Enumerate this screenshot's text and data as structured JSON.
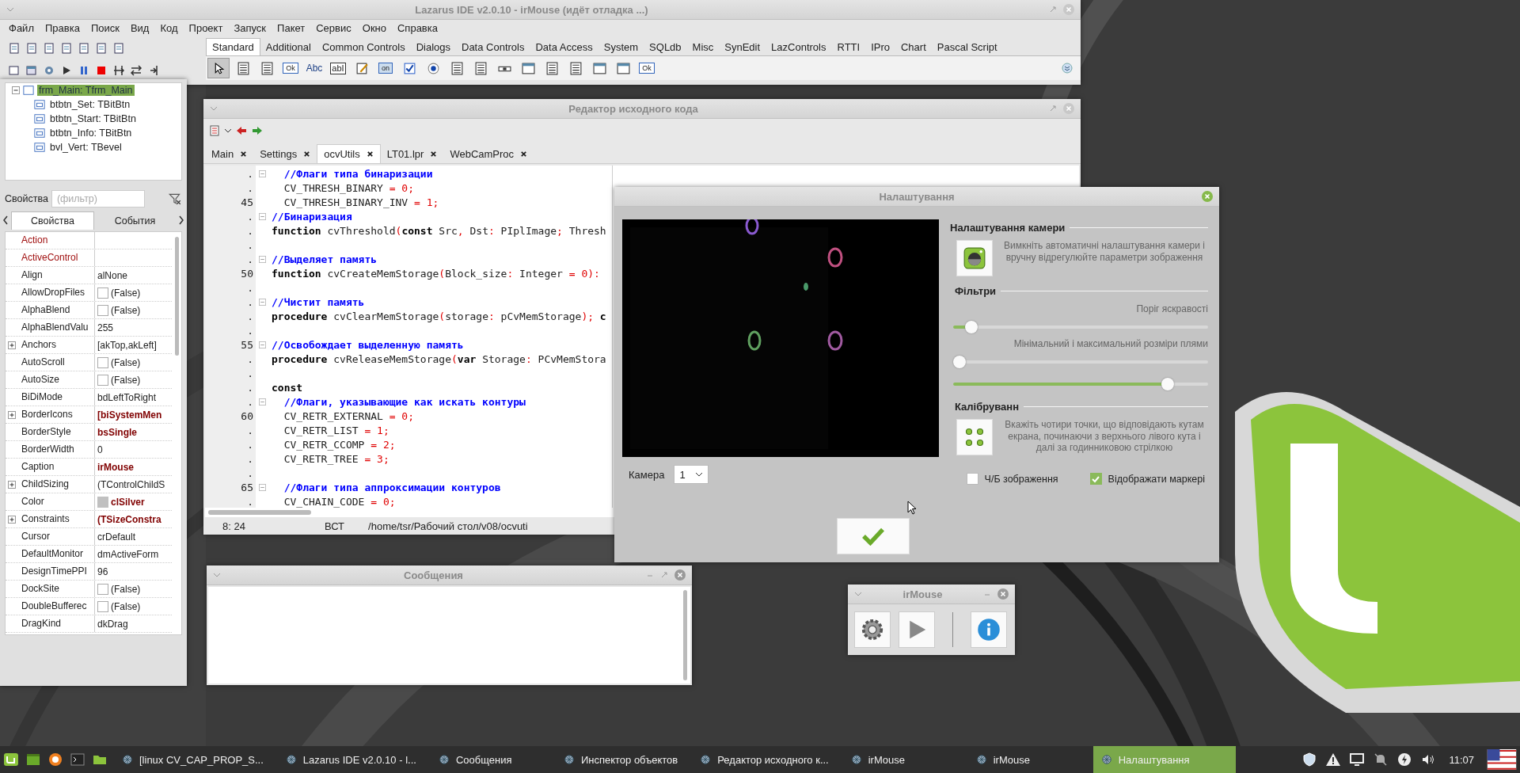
{
  "ide": {
    "title": "Lazarus IDE v2.0.10 - irMouse (идёт отладка ...)",
    "menu": [
      "Файл",
      "Правка",
      "Поиск",
      "Вид",
      "Код",
      "Проект",
      "Запуск",
      "Пакет",
      "Сервис",
      "Окно",
      "Справка"
    ],
    "palette_tabs": [
      {
        "label": "Standard",
        "selected": true
      },
      {
        "label": "Additional",
        "selected": false
      },
      {
        "label": "Common Controls",
        "selected": false
      },
      {
        "label": "Dialogs",
        "selected": false
      },
      {
        "label": "Data Controls",
        "selected": false
      },
      {
        "label": "Data Access",
        "selected": false
      },
      {
        "label": "System",
        "selected": false
      },
      {
        "label": "SQLdb",
        "selected": false
      },
      {
        "label": "Misc",
        "selected": false
      },
      {
        "label": "SynEdit",
        "selected": false
      },
      {
        "label": "LazControls",
        "selected": false
      },
      {
        "label": "RTTI",
        "selected": false
      },
      {
        "label": "IPro",
        "selected": false
      },
      {
        "label": "Chart",
        "selected": false
      },
      {
        "label": "Pascal Script",
        "selected": false
      }
    ],
    "palette_items": [
      {
        "kind": "pointer",
        "selected": true
      },
      {
        "kind": "list",
        "selected": false
      },
      {
        "kind": "list",
        "selected": false
      },
      {
        "kind": "button",
        "label": "Ok",
        "selected": false
      },
      {
        "kind": "label",
        "label": "Abc",
        "selected": false
      },
      {
        "kind": "edit",
        "label": "abI",
        "selected": false
      },
      {
        "kind": "memo",
        "selected": false
      },
      {
        "kind": "toggle",
        "label": "on",
        "selected": false
      },
      {
        "kind": "check",
        "selected": false
      },
      {
        "kind": "radio",
        "selected": false
      },
      {
        "kind": "list",
        "selected": false
      },
      {
        "kind": "list",
        "selected": false
      },
      {
        "kind": "scroll",
        "selected": false
      },
      {
        "kind": "panel",
        "selected": false
      },
      {
        "kind": "list",
        "selected": false
      },
      {
        "kind": "list",
        "selected": false
      },
      {
        "kind": "panel",
        "selected": false
      },
      {
        "kind": "panel",
        "selected": false
      },
      {
        "kind": "button",
        "label": "Ok",
        "selected": false
      }
    ]
  },
  "inspector": {
    "tree": [
      {
        "label": "frm_Main: Tfrm_Main",
        "selected": true,
        "children": [
          {
            "label": "btbtn_Set: TBitBtn",
            "selected": false
          },
          {
            "label": "btbtn_Start: TBitBtn",
            "selected": false
          },
          {
            "label": "btbtn_Info: TBitBtn",
            "selected": false
          },
          {
            "label": "bvl_Vert: TBevel",
            "selected": false
          }
        ]
      }
    ],
    "filter_label": "Свойства",
    "filter_placeholder": "(фильтр)",
    "tabs": [
      {
        "label": "Свойства",
        "selected": true
      },
      {
        "label": "События",
        "selected": false
      }
    ],
    "rows": [
      {
        "name": "Action",
        "kind": "text",
        "highlight": true,
        "expandable": false
      },
      {
        "name": "ActiveControl",
        "kind": "text",
        "highlight": true,
        "expandable": false
      },
      {
        "name": "Align",
        "value": "alNone",
        "kind": "text",
        "highlight": false,
        "expandable": false
      },
      {
        "name": "AllowDropFiles",
        "value": "(False)",
        "kind": "check",
        "checked": false,
        "highlight": false,
        "expandable": false
      },
      {
        "name": "AlphaBlend",
        "value": "(False)",
        "kind": "check",
        "checked": false,
        "highlight": false,
        "expandable": false
      },
      {
        "name": "AlphaBlendValu",
        "value": "255",
        "kind": "text",
        "highlight": false,
        "expandable": false
      },
      {
        "name": "Anchors",
        "value": "[akTop,akLeft]",
        "kind": "text",
        "highlight": false,
        "expandable": true
      },
      {
        "name": "AutoScroll",
        "value": "(False)",
        "kind": "check",
        "checked": false,
        "highlight": false,
        "expandable": false
      },
      {
        "name": "AutoSize",
        "value": "(False)",
        "kind": "check",
        "checked": false,
        "highlight": false,
        "expandable": false
      },
      {
        "name": "BiDiMode",
        "value": "bdLeftToRight",
        "kind": "text",
        "highlight": false,
        "expandable": false
      },
      {
        "name": "BorderIcons",
        "value": "[biSystemMen",
        "kind": "bold",
        "highlight": false,
        "expandable": true
      },
      {
        "name": "BorderStyle",
        "value": "bsSingle",
        "kind": "bold",
        "highlight": false,
        "expandable": false
      },
      {
        "name": "BorderWidth",
        "value": "0",
        "kind": "text",
        "highlight": false,
        "expandable": false
      },
      {
        "name": "Caption",
        "value": "irMouse",
        "kind": "bold",
        "highlight": false,
        "expandable": false
      },
      {
        "name": "ChildSizing",
        "value": "(TControlChildS",
        "kind": "text",
        "highlight": false,
        "expandable": true
      },
      {
        "name": "Color",
        "value": "clSilver",
        "kind": "color",
        "highlight": false,
        "expandable": false
      },
      {
        "name": "Constraints",
        "value": "(TSizeConstra",
        "kind": "bold",
        "highlight": false,
        "expandable": true
      },
      {
        "name": "Cursor",
        "value": "crDefault",
        "kind": "text",
        "highlight": false,
        "expandable": false
      },
      {
        "name": "DefaultMonitor",
        "value": "dmActiveForm",
        "kind": "text",
        "highlight": false,
        "expandable": false
      },
      {
        "name": "DesignTimePPI",
        "value": "96",
        "kind": "text",
        "highlight": false,
        "expandable": false
      },
      {
        "name": "DockSite",
        "value": "(False)",
        "kind": "check",
        "checked": false,
        "highlight": false,
        "expandable": false
      },
      {
        "name": "DoubleBufferec",
        "value": "(False)",
        "kind": "check",
        "checked": false,
        "highlight": false,
        "expandable": false
      },
      {
        "name": "DragKind",
        "value": "dkDrag",
        "kind": "text",
        "highlight": false,
        "expandable": false
      }
    ]
  },
  "editor": {
    "title": "Редактор исходного кода",
    "tabs": [
      {
        "label": "Main",
        "selected": false
      },
      {
        "label": "Settings",
        "selected": false
      },
      {
        "label": "ocvUtils",
        "selected": true
      },
      {
        "label": "LT01.lpr",
        "selected": false
      },
      {
        "label": "WebCamProc",
        "selected": false
      }
    ],
    "lines": [
      {
        "number": ".",
        "fold": true,
        "segments": [
          {
            "kind": "comment",
            "text": "  //Флаги типа бинаризации"
          }
        ]
      },
      {
        "number": ".",
        "fold": false,
        "segments": [
          {
            "kind": "text",
            "text": "  CV_THRESH_BINARY "
          },
          {
            "kind": "symbol",
            "text": "= 0;"
          }
        ]
      },
      {
        "number": "45",
        "fold": false,
        "segments": [
          {
            "kind": "text",
            "text": "  CV_THRESH_BINARY_INV "
          },
          {
            "kind": "symbol",
            "text": "= 1;"
          }
        ]
      },
      {
        "number": ".",
        "fold": true,
        "segments": [
          {
            "kind": "comment",
            "text": "//Бинаризация"
          }
        ]
      },
      {
        "number": ".",
        "fold": false,
        "segments": [
          {
            "kind": "keyword",
            "text": "function"
          },
          {
            "kind": "text",
            "text": " cvThreshold"
          },
          {
            "kind": "symbol",
            "text": "("
          },
          {
            "kind": "keyword",
            "text": "const"
          },
          {
            "kind": "text",
            "text": " Src"
          },
          {
            "kind": "symbol",
            "text": ","
          },
          {
            "kind": "text",
            "text": " Dst"
          },
          {
            "kind": "symbol",
            "text": ":"
          },
          {
            "kind": "text",
            "text": " PIplImage"
          },
          {
            "kind": "symbol",
            "text": ";"
          },
          {
            "kind": "text",
            "text": " Thresh"
          }
        ]
      },
      {
        "number": ".",
        "fold": false
      },
      {
        "number": ".",
        "fold": true,
        "segments": [
          {
            "kind": "comment",
            "text": "//Выделяет память"
          }
        ]
      },
      {
        "number": "50",
        "fold": false,
        "segments": [
          {
            "kind": "keyword",
            "text": "function"
          },
          {
            "kind": "text",
            "text": " cvCreateMemStorage"
          },
          {
            "kind": "symbol",
            "text": "("
          },
          {
            "kind": "text",
            "text": "Block_size"
          },
          {
            "kind": "symbol",
            "text": ":"
          },
          {
            "kind": "text",
            "text": " Integer "
          },
          {
            "kind": "symbol",
            "text": "= 0):"
          }
        ]
      },
      {
        "number": ".",
        "fold": false
      },
      {
        "number": ".",
        "fold": true,
        "segments": [
          {
            "kind": "comment",
            "text": "//Чистит память"
          }
        ]
      },
      {
        "number": ".",
        "fold": false,
        "segments": [
          {
            "kind": "keyword",
            "text": "procedure"
          },
          {
            "kind": "text",
            "text": " cvClearMemStorage"
          },
          {
            "kind": "symbol",
            "text": "("
          },
          {
            "kind": "text",
            "text": "storage"
          },
          {
            "kind": "symbol",
            "text": ":"
          },
          {
            "kind": "text",
            "text": " pCvMemStorage"
          },
          {
            "kind": "symbol",
            "text": ");"
          },
          {
            "kind": "keyword",
            "text": " c"
          }
        ]
      },
      {
        "number": ".",
        "fold": false
      },
      {
        "number": "55",
        "fold": true,
        "segments": [
          {
            "kind": "comment",
            "text": "//Освобождает выделенную память"
          }
        ]
      },
      {
        "number": ".",
        "fold": false,
        "segments": [
          {
            "kind": "keyword",
            "text": "procedure"
          },
          {
            "kind": "text",
            "text": " cvReleaseMemStorage"
          },
          {
            "kind": "symbol",
            "text": "("
          },
          {
            "kind": "keyword",
            "text": "var"
          },
          {
            "kind": "text",
            "text": " Storage"
          },
          {
            "kind": "symbol",
            "text": ":"
          },
          {
            "kind": "text",
            "text": " PCvMemStora"
          }
        ]
      },
      {
        "number": ".",
        "fold": false
      },
      {
        "number": ".",
        "fold": false,
        "segments": [
          {
            "kind": "keyword",
            "text": "const"
          }
        ]
      },
      {
        "number": ".",
        "fold": true,
        "segments": [
          {
            "kind": "comment",
            "text": "  //Флаги, указывающие как искать контуры"
          }
        ]
      },
      {
        "number": "60",
        "fold": false,
        "segments": [
          {
            "kind": "text",
            "text": "  CV_RETR_EXTERNAL "
          },
          {
            "kind": "symbol",
            "text": "= 0;"
          }
        ]
      },
      {
        "number": ".",
        "fold": false,
        "segments": [
          {
            "kind": "text",
            "text": "  CV_RETR_LIST "
          },
          {
            "kind": "symbol",
            "text": "= 1;"
          }
        ]
      },
      {
        "number": ".",
        "fold": false,
        "segments": [
          {
            "kind": "text",
            "text": "  CV_RETR_CCOMP "
          },
          {
            "kind": "symbol",
            "text": "= 2;"
          }
        ]
      },
      {
        "number": ".",
        "fold": false,
        "segments": [
          {
            "kind": "text",
            "text": "  CV_RETR_TREE "
          },
          {
            "kind": "symbol",
            "text": "= 3;"
          }
        ]
      },
      {
        "number": ".",
        "fold": false
      },
      {
        "number": "65",
        "fold": true,
        "segments": [
          {
            "kind": "comment",
            "text": "  //Флаги типа аппроксимации контуров"
          }
        ]
      },
      {
        "number": ".",
        "fold": false,
        "segments": [
          {
            "kind": "text",
            "text": "  CV_CHAIN_CODE "
          },
          {
            "kind": "symbol",
            "text": "= 0;"
          }
        ]
      }
    ],
    "status": {
      "position": "8: 24",
      "mode": "ВСТ",
      "path": "/home/tsr/Рабочий стол/v08/ocvuti"
    }
  },
  "settings": {
    "title": "Налаштування",
    "camera_section": {
      "title": "Налаштування камери",
      "description": "Вимкніть автоматичні налаштування камери і вручну відрегулюйте параметри зображення"
    },
    "filters": {
      "title": "Фільтри",
      "brightness_label": "Поріг яскравості",
      "brightness": {
        "level": 0.05
      },
      "size_label": "Мінімальний і максимальний розміри плями",
      "size_min": {
        "level": 0
      },
      "size_max": {
        "level": 0.86
      }
    },
    "calibration": {
      "title": "Калібруванн",
      "description": "Вкажіть чотири точки, що відповідають кутам екрана, починаючи з верхнього лівого кута і далі за годинниковою стрілкою"
    },
    "camera_label": "Камера",
    "camera_value": "1",
    "checkboxes": [
      {
        "label": "Ч/Б зображення",
        "checked": false
      },
      {
        "label": "Відображати маркері",
        "checked": true
      }
    ]
  },
  "messages": {
    "title": "Сообщения"
  },
  "irmouse": {
    "title": "irMouse",
    "buttons": [
      {
        "kind": "settings"
      },
      {
        "kind": "play"
      },
      {
        "kind": "info"
      }
    ]
  },
  "taskbar": {
    "tasks": [
      {
        "label": "[linux CV_CAP_PROP_S...",
        "selected": false
      },
      {
        "label": "Lazarus IDE v2.0.10 - l...",
        "selected": false
      },
      {
        "label": "Сообщения",
        "selected": false
      },
      {
        "label": "Инспектор объектов",
        "selected": false
      },
      {
        "label": "Редактор исходного к...",
        "selected": false
      },
      {
        "label": "irMouse",
        "selected": false
      },
      {
        "label": "irMouse",
        "selected": false
      },
      {
        "label": "Налаштування",
        "selected": true
      }
    ],
    "clock": "11:07"
  }
}
